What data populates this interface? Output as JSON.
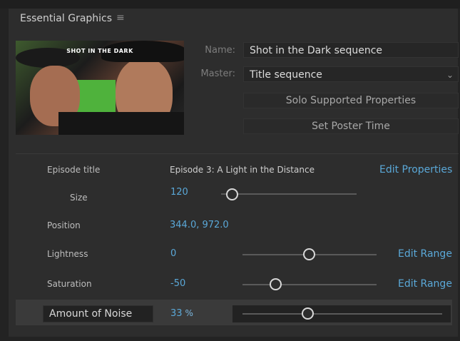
{
  "panel": {
    "title": "Essential Graphics",
    "menu_icon": "hamburger-menu-icon"
  },
  "thumbnail": {
    "overlay_text": "SHOT IN THE DARK"
  },
  "name_field": {
    "label": "Name:",
    "value": "Shot in the Dark sequence"
  },
  "master_field": {
    "label": "Master:",
    "value": "Title sequence",
    "icon": "chevron-down-icon"
  },
  "buttons": {
    "solo": "Solo Supported Properties",
    "poster": "Set Poster Time"
  },
  "properties": {
    "episode_title": {
      "label": "Episode title",
      "value": "Episode 3: A Light in the Distance",
      "link": "Edit Properties"
    },
    "size": {
      "label": "Size",
      "value": "120",
      "slider_level": 0.08
    },
    "position": {
      "label": "Position",
      "value": "344.0, 972.0"
    },
    "lightness": {
      "label": "Lightness",
      "value": "0",
      "slider_level": 0.5,
      "link": "Edit Range"
    },
    "saturation": {
      "label": "Saturation",
      "value": "-50",
      "slider_level": 0.25,
      "link": "Edit Range"
    },
    "noise": {
      "label": "Amount of Noise",
      "value": "33",
      "unit": "%",
      "slider_level": 0.33
    }
  },
  "colors": {
    "accent": "#5aa8d8",
    "background": "#2d2d2d"
  }
}
